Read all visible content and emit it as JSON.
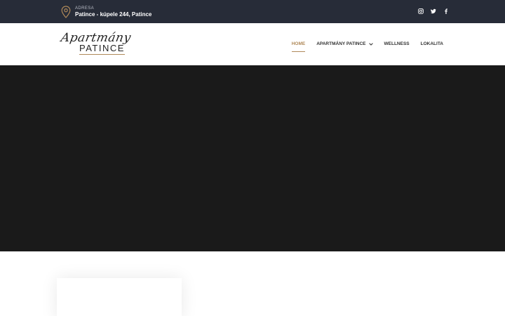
{
  "topbar": {
    "address_label": "ADRESA",
    "address_value": "Patince - kúpele 244, Patince",
    "social": [
      "instagram-icon",
      "twitter-icon",
      "facebook-icon"
    ]
  },
  "logo": {
    "script": "Apartmány",
    "block": "PATINCE"
  },
  "nav": {
    "items": [
      {
        "label": "HOME",
        "active": true
      },
      {
        "label": "APARTMÁNY PATINCE",
        "has_dropdown": true
      },
      {
        "label": "WELLNESS"
      },
      {
        "label": "LOKALITA"
      }
    ]
  },
  "colors": {
    "topbar_bg": "#272c38",
    "accent": "#b08a5a",
    "hero_bg": "#1a1a1a"
  }
}
